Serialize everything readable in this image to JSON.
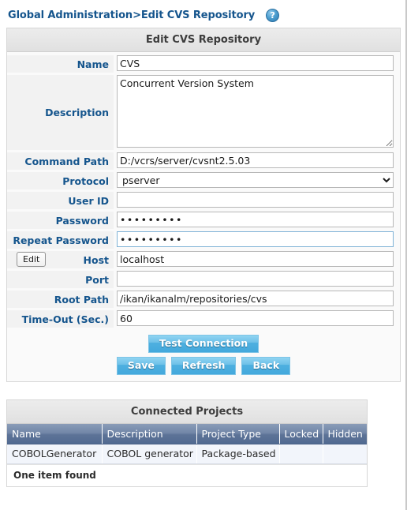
{
  "breadcrumb": {
    "text": "Global Administration>Edit CVS Repository",
    "help_icon": "help-question-icon",
    "help_glyph": "?"
  },
  "form": {
    "title": "Edit CVS Repository",
    "fields": [
      {
        "label": "Name",
        "value": "CVS",
        "type": "text"
      },
      {
        "label": "Description",
        "value": "Concurrent Version System",
        "type": "textarea"
      },
      {
        "label": "Command Path",
        "value": "D:/vcrs/server/cvsnt2.5.03",
        "type": "text"
      },
      {
        "label": "Protocol",
        "value": "pserver",
        "type": "select",
        "options": [
          "pserver"
        ]
      },
      {
        "label": "User ID",
        "value": "",
        "type": "text"
      },
      {
        "label": "Password",
        "value": "•••••••••",
        "type": "password"
      },
      {
        "label": "Repeat Password",
        "value": "•••••••••",
        "type": "password",
        "focused": true
      },
      {
        "label": "Host",
        "value": "localhost",
        "type": "text",
        "side_button": "Edit"
      },
      {
        "label": "Port",
        "value": "",
        "type": "text"
      },
      {
        "label": "Root Path",
        "value": "/ikan/ikanalm/repositories/cvs",
        "type": "text"
      },
      {
        "label": "Time-Out (Sec.)",
        "value": "60",
        "type": "text"
      }
    ],
    "buttons": {
      "test_connection": "Test Connection",
      "save": "Save",
      "refresh": "Refresh",
      "back": "Back"
    }
  },
  "connected_projects": {
    "title": "Connected Projects",
    "columns": [
      "Name",
      "Description",
      "Project Type",
      "Locked",
      "Hidden"
    ],
    "rows": [
      {
        "name": "COBOLGenerator",
        "description": "COBOL generator",
        "project_type": "Package-based",
        "locked": "",
        "hidden": ""
      }
    ],
    "footer": "One item found"
  },
  "colors": {
    "link_blue": "#15558d",
    "button_blue": "#4fb0e0",
    "table_header": "#5d7397",
    "panel_header": "#e6e6e6"
  }
}
